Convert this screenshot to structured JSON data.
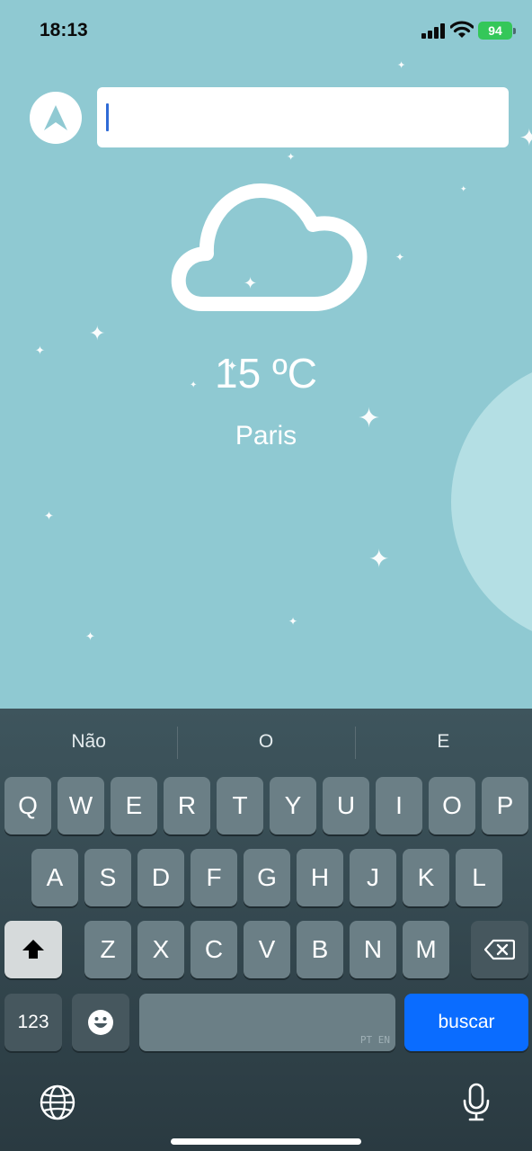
{
  "status_bar": {
    "time": "18:13",
    "battery": "94"
  },
  "search": {
    "value": ""
  },
  "weather": {
    "temperature": "15 ºC",
    "city": "Paris"
  },
  "keyboard": {
    "suggestions": [
      "Não",
      "O",
      "E"
    ],
    "row1": [
      "Q",
      "W",
      "E",
      "R",
      "T",
      "Y",
      "U",
      "I",
      "O",
      "P"
    ],
    "row2": [
      "A",
      "S",
      "D",
      "F",
      "G",
      "H",
      "J",
      "K",
      "L"
    ],
    "row3": [
      "Z",
      "X",
      "C",
      "V",
      "B",
      "N",
      "M"
    ],
    "numbers_key": "123",
    "space_languages": "PT EN",
    "action_key": "buscar"
  },
  "icons": {
    "navigation": "location-arrow-icon",
    "weather": "cloud-icon",
    "shift": "shift-icon",
    "backspace": "backspace-icon",
    "emoji": "emoji-icon",
    "globe": "globe-icon",
    "mic": "mic-icon"
  },
  "colors": {
    "background": "#8fc9d2",
    "action": "#0a6cff",
    "battery": "#34c759"
  }
}
